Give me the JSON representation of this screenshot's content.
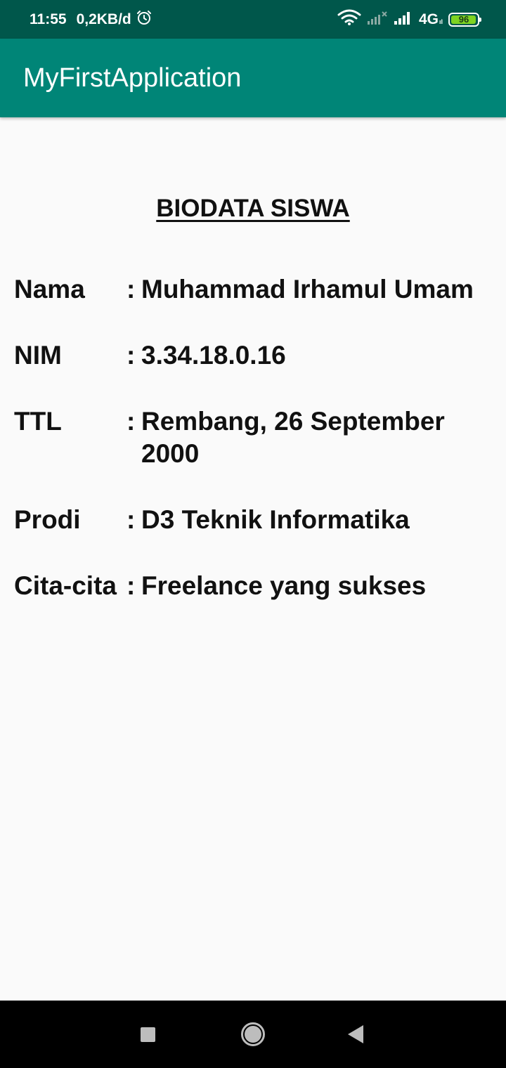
{
  "status_bar": {
    "time": "11:55",
    "speed": "0,2KB/d",
    "alarm_icon": "alarm-clock-icon",
    "wifi_icon": "wifi-icon",
    "signal1_icon": "no-signal-icon",
    "signal2_icon": "signal-bars-icon",
    "network": "4G",
    "network_sub": "ıl",
    "battery_level": "96",
    "battery_fraction": 0.96,
    "battery_color": "#7ed321"
  },
  "app_bar": {
    "title": "MyFirstApplication",
    "background": "#008577"
  },
  "content": {
    "title": "BIODATA SISWA",
    "rows": [
      {
        "label": "Nama",
        "sep": ":",
        "value": "Muhammad Irhamul Umam"
      },
      {
        "label": "NIM",
        "sep": ":",
        "value": "3.34.18.0.16"
      },
      {
        "label": "TTL",
        "sep": ":",
        "value": "Rembang, 26 September 2000"
      },
      {
        "label": "Prodi",
        "sep": ":",
        "value": "D3 Teknik Informatika"
      },
      {
        "label": "Cita-cita",
        "sep": ":",
        "value": "Freelance yang sukses"
      }
    ]
  },
  "nav_bar": {
    "recent_icon": "recent-apps-icon",
    "home_icon": "home-icon",
    "back_icon": "back-icon"
  }
}
